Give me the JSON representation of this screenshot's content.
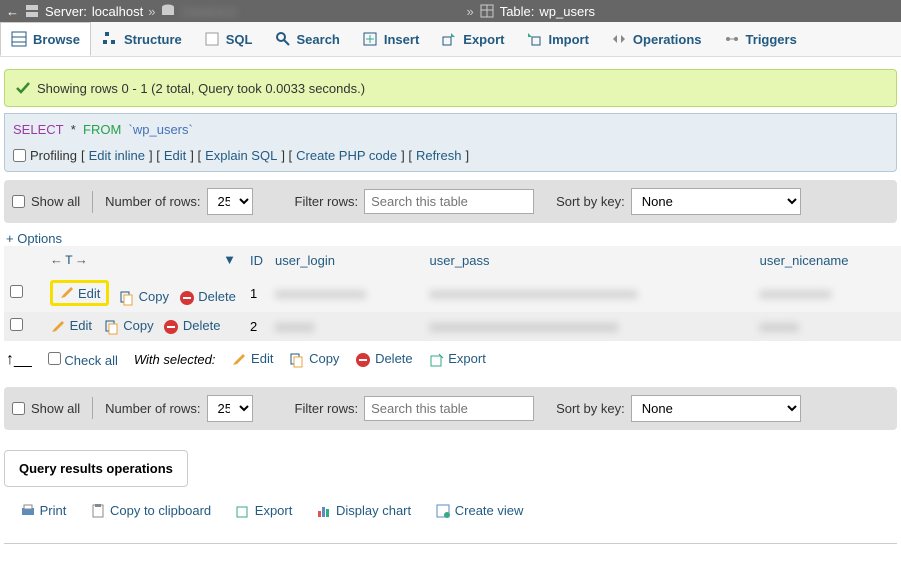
{
  "breadcrumb": {
    "server_label": "Server:",
    "server_value": "localhost",
    "database_label": "Database",
    "database_value": "(redacted)",
    "table_label": "Table:",
    "table_value": "wp_users"
  },
  "tabs": [
    "Browse",
    "Structure",
    "SQL",
    "Search",
    "Insert",
    "Export",
    "Import",
    "Operations",
    "Triggers"
  ],
  "success": "Showing rows 0 - 1 (2 total, Query took 0.0033 seconds.)",
  "sql": {
    "select": "SELECT",
    "star": "*",
    "from": "FROM",
    "ident": "`wp_users`"
  },
  "query_links": {
    "profiling": "Profiling",
    "edit_inline": "Edit inline",
    "edit": "Edit",
    "explain": "Explain SQL",
    "php": "Create PHP code",
    "refresh": "Refresh"
  },
  "toolbar": {
    "show_all": "Show all",
    "num_rows": "Number of rows:",
    "rows_value": "25",
    "filter": "Filter rows:",
    "search_ph": "Search this table",
    "sort_by": "Sort by key:",
    "sort_value": "None"
  },
  "options": "+ Options",
  "columns": {
    "id": "ID",
    "user_login": "user_login",
    "user_pass": "user_pass",
    "user_nicename": "user_nicename"
  },
  "rows": [
    {
      "edit": "Edit",
      "copy": "Copy",
      "delete": "Delete",
      "id": "1"
    },
    {
      "edit": "Edit",
      "copy": "Copy",
      "delete": "Delete",
      "id": "2"
    }
  ],
  "bulk": {
    "check_all": "Check all",
    "with_selected": "With selected:",
    "edit": "Edit",
    "copy": "Copy",
    "delete": "Delete",
    "export": "Export"
  },
  "results_ops": {
    "title": "Query results operations",
    "print": "Print",
    "clipboard": "Copy to clipboard",
    "export": "Export",
    "chart": "Display chart",
    "view": "Create view"
  }
}
